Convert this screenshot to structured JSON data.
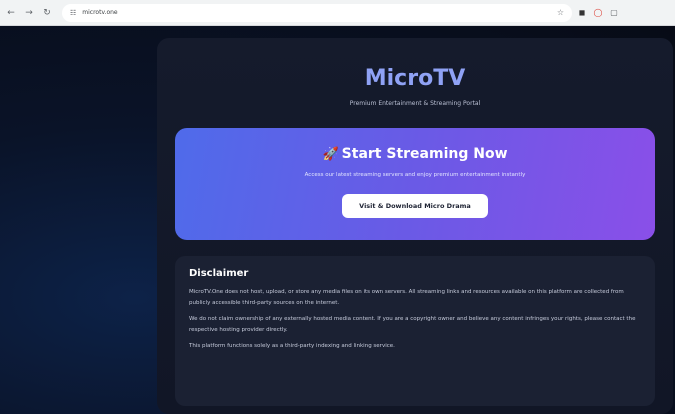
{
  "browser": {
    "url": "microtv.one",
    "back_icon": "arrow-left-icon",
    "forward_icon": "arrow-right-icon",
    "reload_icon": "reload-icon"
  },
  "header": {
    "brand": "MicroTV",
    "tagline": "Premium Entertainment & Streaming Portal"
  },
  "hero": {
    "title": "Start Streaming Now",
    "subtitle": "Access our latest streaming servers and enjoy premium entertainment instantly",
    "button_label": "Visit & Download Micro Drama",
    "colors": {
      "start": "#4f6bea",
      "end": "#8a4fe8"
    }
  },
  "disclaimer": {
    "title": "Disclaimer",
    "paragraphs": [
      "MicroTV.One does not host, upload, or store any media files on its own servers. All streaming links and resources available on this platform are collected from publicly accessible third-party sources on the internet.",
      "We do not claim ownership of any externally hosted media content. If you are a copyright owner and believe any content infringes your rights, please contact the respective hosting provider directly.",
      "This platform functions solely as a third-party indexing and linking service."
    ]
  },
  "colors": {
    "brand": "#8fa2f5",
    "background": "#0b0f1e",
    "card": "#151b2c"
  }
}
